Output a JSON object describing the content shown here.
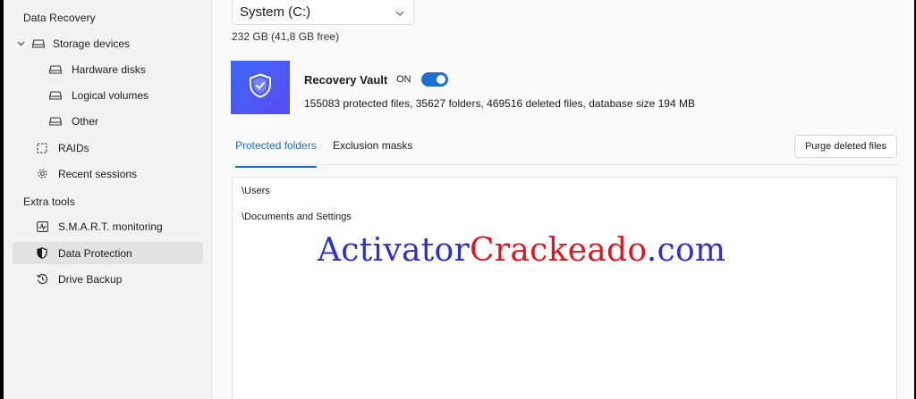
{
  "sidebar": {
    "data_recovery_title": "Data Recovery",
    "storage_devices": "Storage devices",
    "hardware_disks": "Hardware disks",
    "logical_volumes": "Logical volumes",
    "other": "Other",
    "raids": "RAIDs",
    "recent_sessions": "Recent sessions",
    "extra_tools_title": "Extra tools",
    "smart_monitoring": "S.M.A.R.T. monitoring",
    "data_protection": "Data Protection",
    "drive_backup": "Drive Backup"
  },
  "volume": {
    "selected": "System (C:)",
    "info": "232 GB (41,8 GB free)"
  },
  "vault": {
    "title": "Recovery Vault",
    "state": "ON",
    "enabled": true,
    "stats": "155083 protected files, 35627 folders, 469516 deleted files, database size 194 MB"
  },
  "tabs": {
    "protected_folders": "Protected folders",
    "exclusion_masks": "Exclusion masks"
  },
  "purge_button": "Purge deleted files",
  "folders": [
    "\\Users",
    "\\Documents and Settings"
  ],
  "watermark": {
    "part1": "Activator",
    "part2": "Crackeado",
    "part3": ".com"
  },
  "colors": {
    "accent": "#1a6fc4",
    "vault_gradient_start": "#3a67f5",
    "vault_gradient_end": "#5a4cf0",
    "watermark_blue": "#2d32c8",
    "watermark_red": "#e0161e"
  },
  "icons": {
    "storage": "drive-icon",
    "raids": "raid-icon",
    "recent": "gear-icon",
    "smart": "pulse-icon",
    "protection": "shield-icon",
    "backup": "history-icon",
    "vault": "shield-check-icon",
    "select": "chevron-down-icon"
  }
}
